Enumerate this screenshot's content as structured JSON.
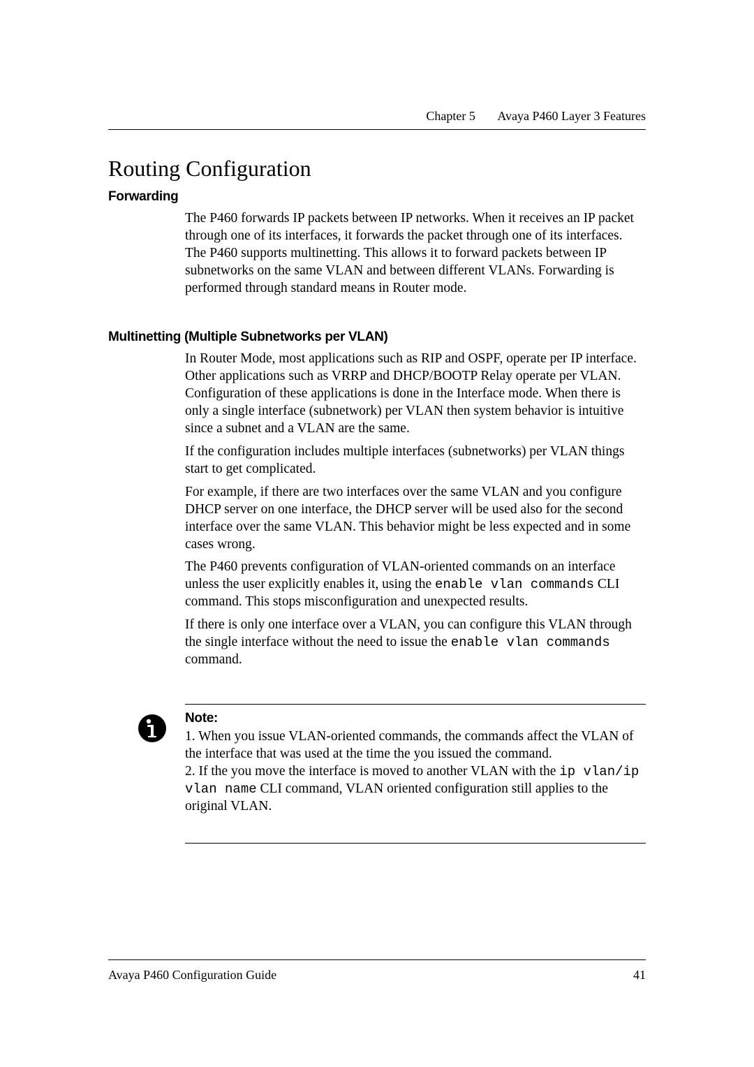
{
  "header": {
    "chapter": "Chapter 5",
    "title": "Avaya P460 Layer 3 Features"
  },
  "h1": "Routing Configuration",
  "section_forwarding": {
    "heading": "Forwarding",
    "body": "The P460 forwards IP packets between IP networks. When it receives an IP packet through one of its interfaces, it forwards the packet through one of its interfaces. The P460 supports multinetting. This allows it to forward packets between IP subnetworks on the same VLAN and between different VLANs. Forwarding is performed through standard means in Router mode."
  },
  "section_multinetting": {
    "heading": "Multinetting (Multiple Subnetworks per VLAN)",
    "p1": "In Router Mode, most applications such as RIP and OSPF, operate per IP interface. Other applications such as VRRP and DHCP/BOOTP Relay operate per VLAN. Configuration of these applications is done in the Interface mode. When there is only a single interface (subnetwork) per VLAN then system behavior is intuitive since a subnet and a VLAN are the same.",
    "p2": "If the configuration includes multiple interfaces (subnetworks) per VLAN things start to get complicated.",
    "p3": "For example, if there are two interfaces over the same VLAN and you configure DHCP server on one interface, the DHCP server will be used also for the second interface over the same VLAN. This behavior might be less expected and in some cases wrong.",
    "p4_pre": "The P460 prevents configuration of VLAN-oriented commands on an interface unless the user explicitly enables it, using the ",
    "p4_code": "enable vlan commands",
    "p4_post": " CLI command. This stops misconfiguration and unexpected results.",
    "p5_pre": "If there is only one interface over a VLAN, you can configure this VLAN through the single interface without the need to issue the ",
    "p5_code": "enable vlan commands",
    "p5_post": " command."
  },
  "note": {
    "heading": "Note:",
    "l1": "1. When you issue VLAN-oriented commands, the commands affect the VLAN of the interface that was used at the time the you issued the command.",
    "l2_pre": "2. If the you move the interface is moved to another VLAN with the ",
    "l2_code": "ip vlan/ip vlan name",
    "l2_post": " CLI command, VLAN oriented configuration still applies to the original VLAN."
  },
  "footer": {
    "left": "Avaya P460 Configuration Guide",
    "page": "41"
  }
}
